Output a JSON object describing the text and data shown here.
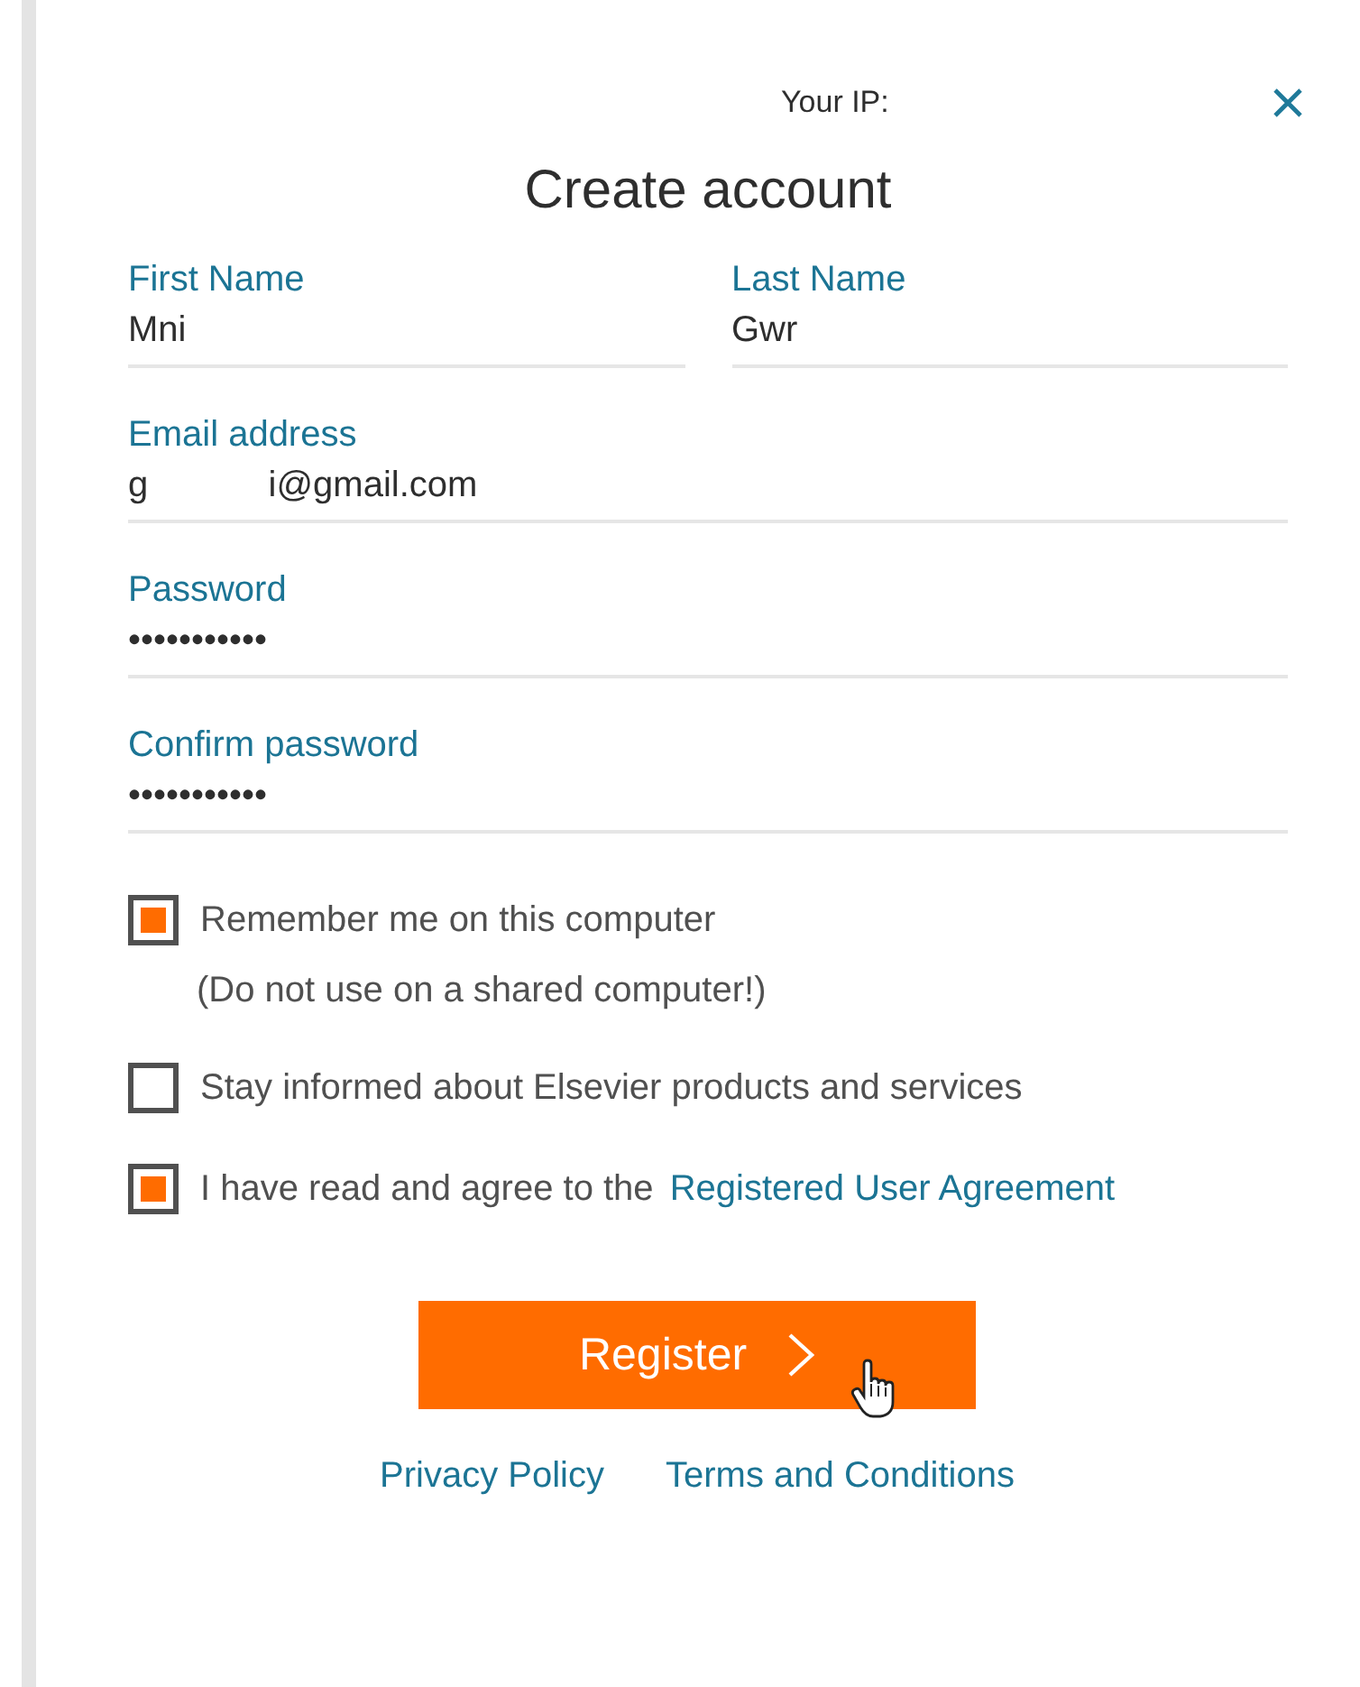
{
  "header": {
    "ip_label": "Your IP:"
  },
  "title": "Create account",
  "name_fields": [
    {
      "label": "First Name",
      "value": "Mni"
    },
    {
      "label": "Last Name",
      "value": "Gwr"
    }
  ],
  "fields": [
    {
      "label": "Email address",
      "value": "g            i@gmail.com"
    },
    {
      "label": "Password",
      "value": "•••••••••••"
    },
    {
      "label": "Confirm password",
      "value": "•••••••••••"
    }
  ],
  "options": [
    {
      "label": "Remember me on this computer",
      "note": "(Do not use on a shared computer!)",
      "checked": true
    },
    {
      "label": "Stay informed about Elsevier products and services",
      "checked": false
    },
    {
      "label": "I have read and agree to the",
      "link": "Registered User Agreement",
      "checked": true
    }
  ],
  "button": {
    "label": "Register"
  },
  "footer_links": [
    "Privacy Policy",
    "Terms and Conditions"
  ]
}
